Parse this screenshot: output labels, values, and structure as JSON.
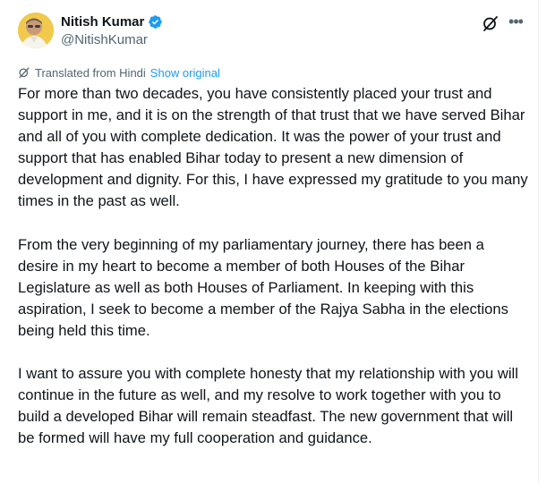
{
  "author": {
    "display_name": "Nitish Kumar",
    "handle": "@NitishKumar",
    "verified": true,
    "avatar_icon": "profile-photo"
  },
  "actions": {
    "grok_icon": "grok-icon",
    "more_icon": "more-icon"
  },
  "translation": {
    "label": "Translated from Hindi",
    "show_original": "Show original"
  },
  "tweet": {
    "paragraphs": [
      "For more than two decades, you have consistently placed your trust and support in me, and it is on the strength of that trust that we have served Bihar and all of you with complete dedication. It was the power of your trust and support that has enabled Bihar today to present a new dimension of development and dignity. For this, I have expressed my gratitude to you many times in the past as well.",
      "From the very beginning of my parliamentary journey, there has been a desire in my heart to become a member of both Houses of the Bihar Legislature as well as both Houses of Parliament. In keeping with this aspiration, I seek to become a member of the Rajya Sabha in the elections being held this time.",
      "I want to assure you with complete honesty that my relationship with you will continue in the future as well, and my resolve to work together with you to build a developed Bihar will remain steadfast. The new government that will be formed will have my full cooperation and guidance."
    ]
  },
  "colors": {
    "text": "#0f1419",
    "secondary": "#536471",
    "link": "#1d9bf0",
    "verified": "#1d9bf0"
  }
}
